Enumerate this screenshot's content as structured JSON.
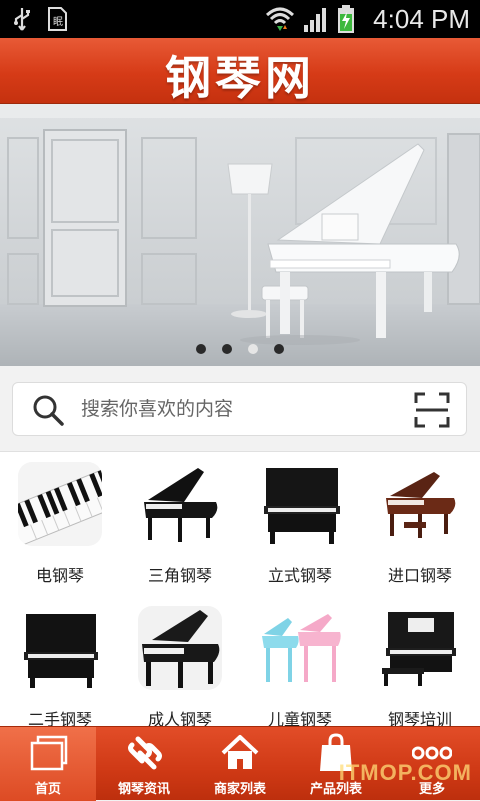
{
  "status_bar": {
    "time": "4:04 PM",
    "icons": [
      "usb-icon",
      "sim-card-icon",
      "wifi-icon",
      "signal-icon",
      "battery-charging-icon"
    ]
  },
  "header": {
    "title": "钢琴网"
  },
  "banner": {
    "slide_count": 4,
    "active_slide": 3
  },
  "search": {
    "placeholder": "搜索你喜欢的内容",
    "icons": [
      "search-icon",
      "scan-icon"
    ]
  },
  "categories": [
    {
      "label": "电钢琴",
      "icon": "keyboard-closeup"
    },
    {
      "label": "三角钢琴",
      "icon": "black-grand-piano"
    },
    {
      "label": "立式钢琴",
      "icon": "black-upright-piano"
    },
    {
      "label": "进口钢琴",
      "icon": "brown-grand-piano"
    },
    {
      "label": "二手钢琴",
      "icon": "black-upright-piano"
    },
    {
      "label": "成人钢琴",
      "icon": "black-grand-piano"
    },
    {
      "label": "儿童钢琴",
      "icon": "toy-pianos"
    },
    {
      "label": "钢琴培训",
      "icon": "upright-piano-with-bench"
    }
  ],
  "tabbar": {
    "active": 0,
    "tabs": [
      {
        "label": "首页",
        "icon": "home-screens-icon"
      },
      {
        "label": "钢琴资讯",
        "icon": "link-icon"
      },
      {
        "label": "商家列表",
        "icon": "house-icon"
      },
      {
        "label": "产品列表",
        "icon": "shopping-bag-icon"
      },
      {
        "label": "更多",
        "icon": "more-dots-icon"
      }
    ]
  },
  "watermark": "ITMOP.COM",
  "colors": {
    "accent": "#d63b17",
    "tab_active": "#e8603a"
  }
}
